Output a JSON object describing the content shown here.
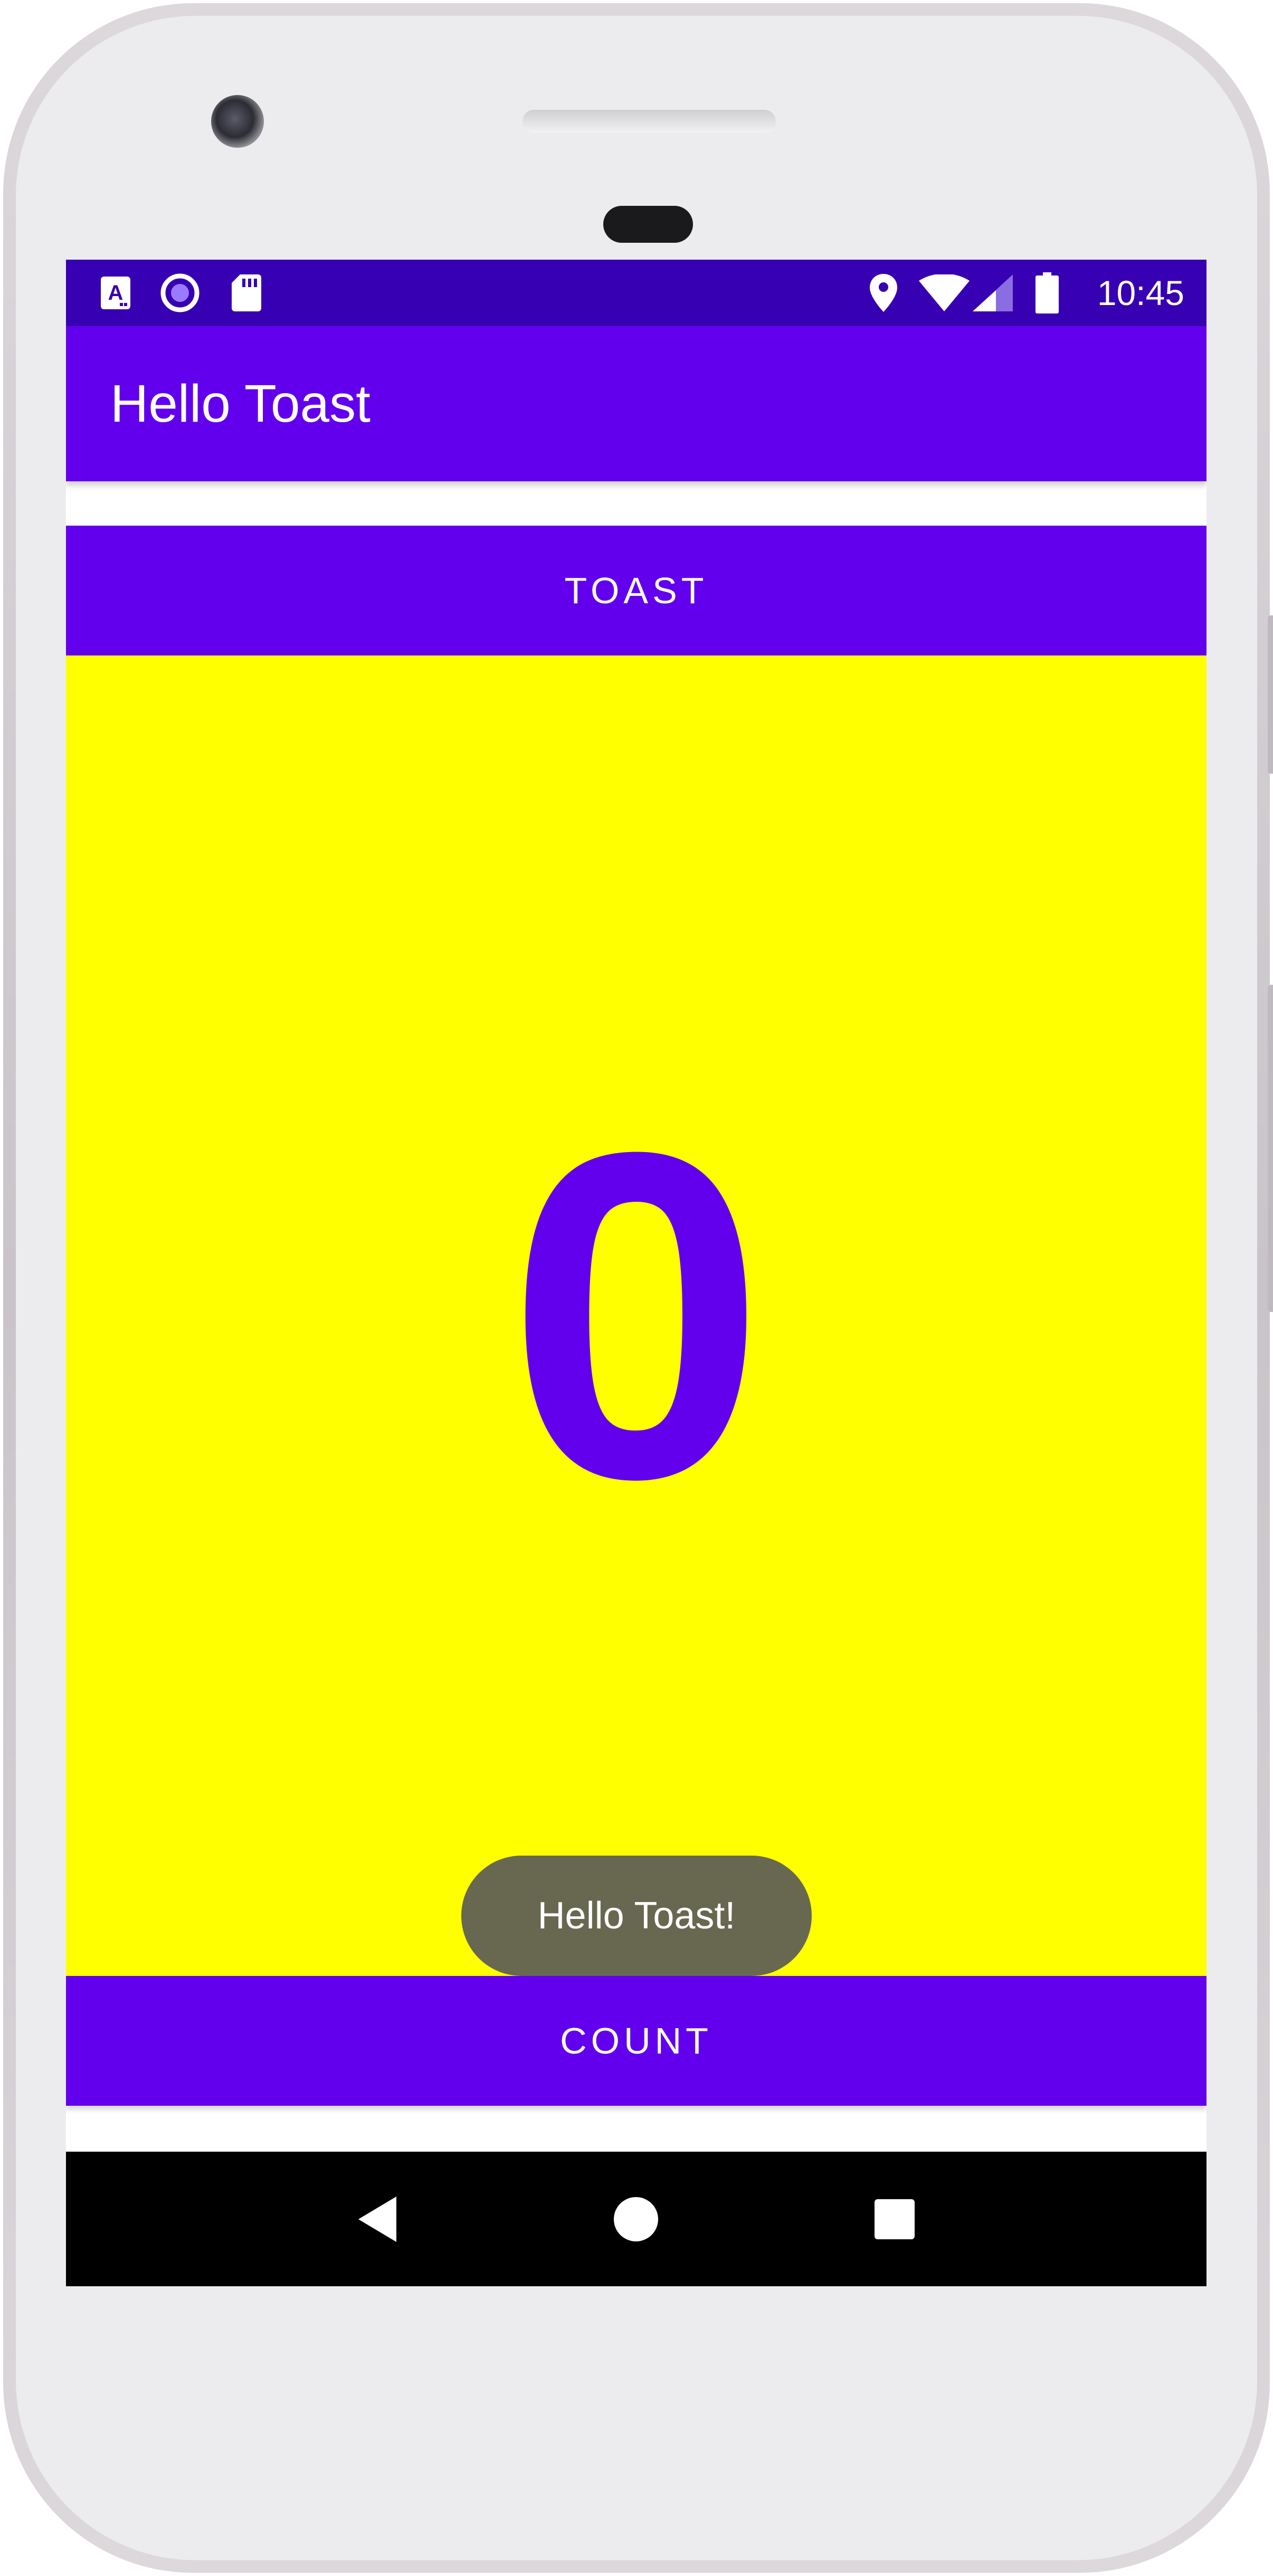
{
  "status_bar": {
    "time": "10:45",
    "icons": [
      "accessibility-a-icon",
      "circle-record-icon",
      "sd-card-icon",
      "location-pin-icon",
      "wifi-icon",
      "cell-signal-icon",
      "battery-icon"
    ]
  },
  "app_bar": {
    "title": "Hello Toast"
  },
  "main": {
    "toast_button_label": "TOAST",
    "count_value": "0",
    "count_button_label": "COUNT"
  },
  "toast_message": "Hello Toast!",
  "navigation_bar": {
    "icons": [
      "back-icon",
      "home-icon",
      "recents-icon"
    ]
  },
  "colors": {
    "status_bar": "#3700b3",
    "primary": "#6200ee",
    "count_background": "#ffff00",
    "toast_background": "#686850",
    "nav_bar": "#000000"
  }
}
